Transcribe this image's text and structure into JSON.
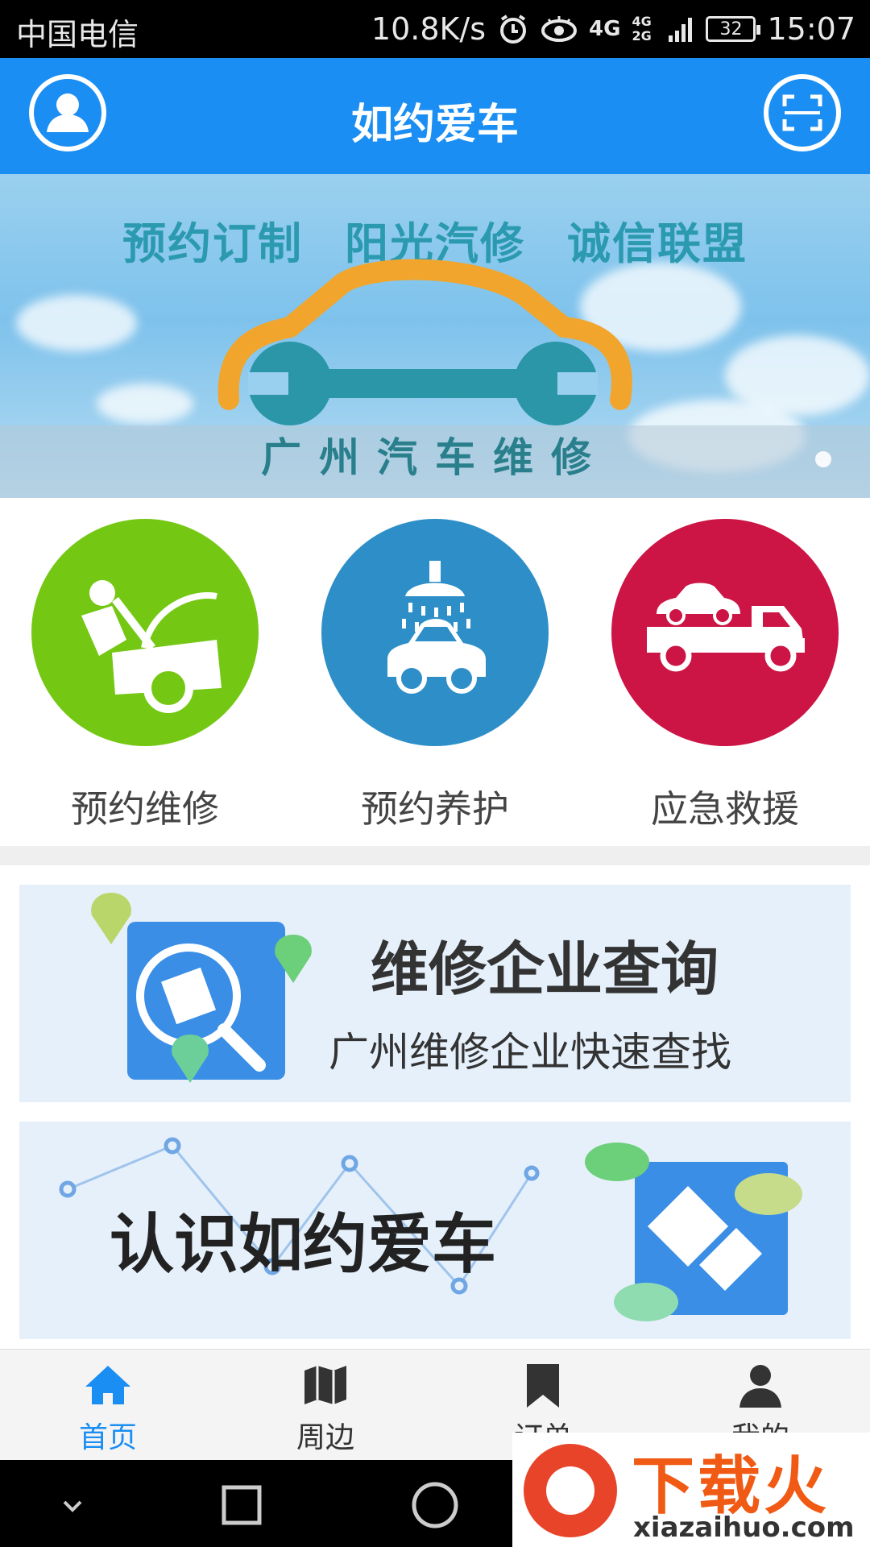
{
  "status_bar": {
    "carrier": "中国电信",
    "speed": "10.8K/s",
    "network_4g": "4G",
    "network_4g_2g": "4G 2G",
    "battery": "32",
    "time": "15:07"
  },
  "header": {
    "title": "如约爱车",
    "left_icon": "user-icon",
    "right_icon": "scan-icon"
  },
  "banner": {
    "slogans": [
      "预约订制",
      "阳光汽修",
      "诚信联盟"
    ],
    "subtitle": "广州汽车维修",
    "colors": {
      "slogan": "#2b9ab0",
      "car_outline": "#f2a52c",
      "wrench": "#2a96a8"
    }
  },
  "services": [
    {
      "label": "预约维修",
      "icon": "car-repair-icon",
      "color": "#74c814"
    },
    {
      "label": "预约养护",
      "icon": "car-wash-icon",
      "color": "#2e8fc8"
    },
    {
      "label": "应急救援",
      "icon": "tow-truck-icon",
      "color": "#cc1544"
    }
  ],
  "cards": {
    "enterprise_query": {
      "title": "维修企业查询",
      "subtitle": "广州维修企业快速查找",
      "icon": "search-enterprise-icon"
    },
    "about": {
      "title": "认识如约爱车",
      "icon": "app-logo-icon"
    }
  },
  "bottom_nav": [
    {
      "label": "首页",
      "icon": "home-icon",
      "active": true
    },
    {
      "label": "周边",
      "icon": "map-icon",
      "active": false
    },
    {
      "label": "订单",
      "icon": "bookmark-icon",
      "active": false
    },
    {
      "label": "我的",
      "icon": "person-icon",
      "active": false
    }
  ],
  "watermark": {
    "text": "下载火",
    "url": "xiazaihuo.com"
  },
  "colors": {
    "primary": "#1a8ef2",
    "status_bar": "#000000",
    "card_bg": "#e6f0fb",
    "nav_bg": "#f4f4f4"
  }
}
